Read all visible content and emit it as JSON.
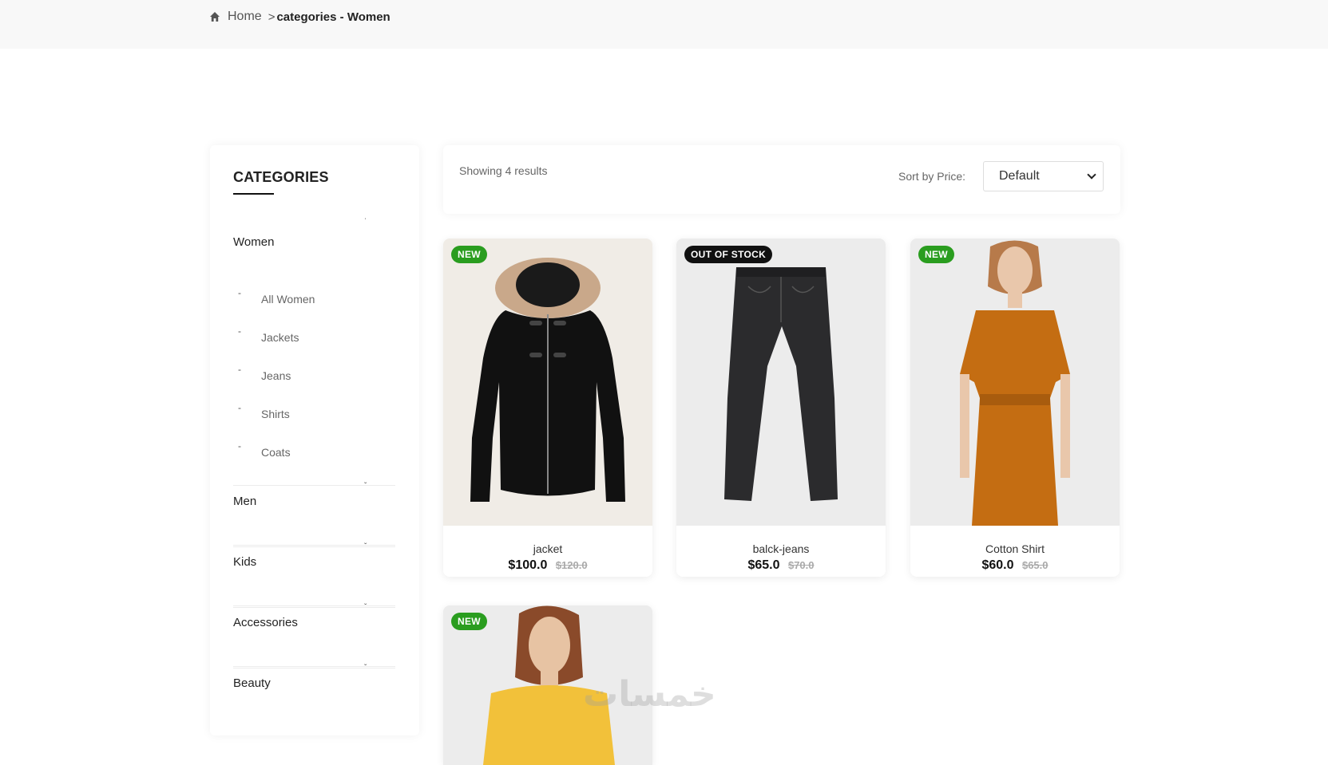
{
  "breadcrumb": {
    "home": "Home",
    "separator": ">",
    "current": "categories - Women"
  },
  "sidebar": {
    "title": "CATEGORIES",
    "categories": [
      {
        "name": "Women",
        "expanded": true,
        "items": [
          "All Women",
          "Jackets",
          "Jeans",
          "Shirts",
          "Coats"
        ]
      },
      {
        "name": "Men"
      },
      {
        "name": "Kids"
      },
      {
        "name": "Accessories"
      },
      {
        "name": "Beauty"
      }
    ]
  },
  "toolbar": {
    "results": "Showing 4 results",
    "sort_label": "Sort by Price:",
    "sort_value": "Default"
  },
  "products": [
    {
      "name": "jacket",
      "price": "$100.0",
      "old_price": "$120.0",
      "badge": "NEW",
      "image": "black-coat-image"
    },
    {
      "name": "balck-jeans",
      "price": "$65.0",
      "old_price": "$70.0",
      "badge": "OUT OF STOCK",
      "image": "black-jeans-image"
    },
    {
      "name": "Cotton Shirt",
      "price": "$60.0",
      "old_price": "$65.0",
      "badge": "NEW",
      "image": "orange-dress-image"
    },
    {
      "badge": "NEW",
      "image": "yellow-sweater-image"
    }
  ],
  "colors": {
    "badge_new": "#2a9d1f",
    "badge_out_of_stock": "#111111",
    "topbar_bg": "#f8f8f8"
  },
  "watermark": "خمسات"
}
